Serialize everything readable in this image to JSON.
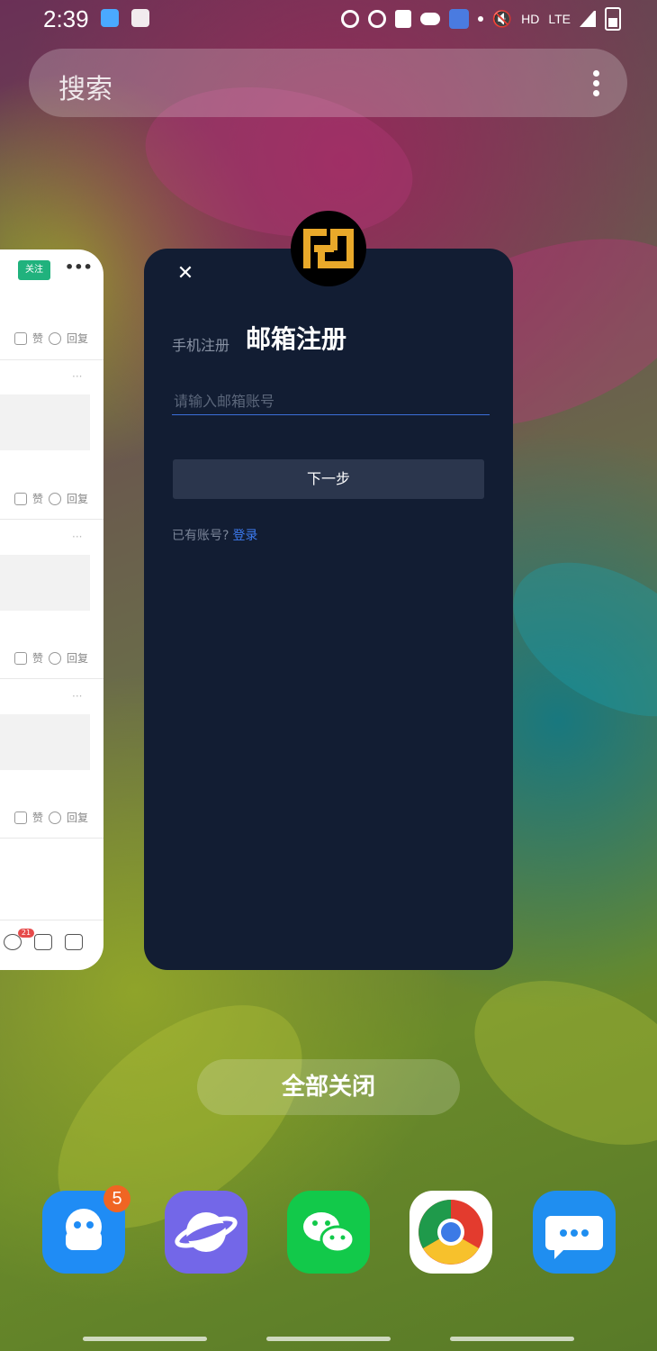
{
  "status_bar": {
    "time": "2:39",
    "network": "HD",
    "lte": "LTE"
  },
  "search": {
    "placeholder": "搜索"
  },
  "left_card": {
    "follow_label": "关注",
    "like_label": "赞",
    "reply_label": "回复",
    "comment_count": "21"
  },
  "main_card": {
    "tab_phone": "手机注册",
    "tab_email": "邮箱注册",
    "email_placeholder": "请输入邮箱账号",
    "next_label": "下一步",
    "has_account": "已有账号?",
    "login_label": "登录"
  },
  "close_all_label": "全部关闭",
  "dock": {
    "qq_badge": "5",
    "apps": [
      "qq-icon",
      "samsung-internet-icon",
      "wechat-icon",
      "chrome-icon",
      "messages-icon"
    ]
  }
}
